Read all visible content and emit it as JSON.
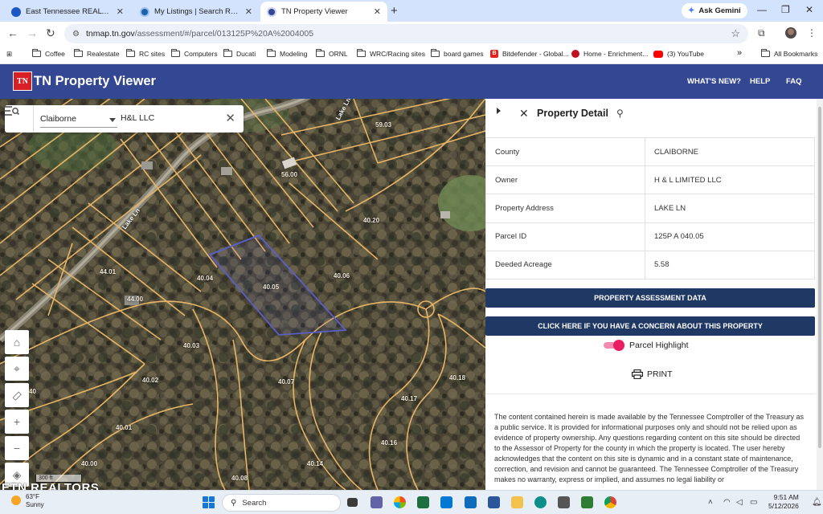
{
  "browser": {
    "tabs": [
      {
        "title": "East Tennessee REALTORS® Da",
        "active": false,
        "favicon_color": "#1a56c4"
      },
      {
        "title": "My Listings | Search Results | fle",
        "active": false,
        "favicon_color": "#1d5fa8"
      },
      {
        "title": "TN Property Viewer",
        "active": true,
        "favicon_color": "#334792"
      }
    ],
    "new_tab_label": "+",
    "ask_gemini_label": "Ask Gemini",
    "url_host": "tnmap.tn.gov",
    "url_path": "/assessment/#/parcel/013125P%20A%2004005",
    "bookmarks": [
      {
        "label": "Coffee",
        "type": "folder"
      },
      {
        "label": "Realestate",
        "type": "folder"
      },
      {
        "label": "RC sites",
        "type": "folder"
      },
      {
        "label": "Computers",
        "type": "folder"
      },
      {
        "label": "Ducati",
        "type": "folder"
      },
      {
        "label": "Modeling",
        "type": "folder"
      },
      {
        "label": "ORNL",
        "type": "folder"
      },
      {
        "label": "WRC/Racing sites",
        "type": "folder"
      },
      {
        "label": "board games",
        "type": "folder"
      },
      {
        "label": "Bitdefender - Global...",
        "type": "link",
        "icon_color": "#e2231a"
      },
      {
        "label": "Home - Enrichment...",
        "type": "link",
        "icon_color": "#c1121f"
      },
      {
        "label": "(3) YouTube",
        "type": "link",
        "icon_color": "#ff0000"
      }
    ],
    "more_bookmarks": "»",
    "all_bookmarks_label": "All Bookmarks"
  },
  "app": {
    "logo_text": "TN",
    "title": "TN Property Viewer",
    "nav": [
      "WHAT'S NEW?",
      "HELP",
      "FAQ"
    ],
    "header_color": "#334792",
    "brand_red": "#d71f26"
  },
  "search": {
    "county": "Claiborne",
    "query": "H&L LLC"
  },
  "map": {
    "road_label": "Lake Ln",
    "scale_label": "300 ft",
    "parcel_labels": [
      "59.03",
      "56.00",
      "40.20",
      "44.01",
      "40.04",
      "40.05",
      "40.06",
      "44.00",
      "40.03",
      "40.02",
      "40.07",
      "40.18",
      "40.17",
      "40.01",
      "40.16",
      "40.00",
      "40.14",
      "40.08",
      "40"
    ],
    "parcel_line_color": "#e6b565",
    "highlight_color": "#5b5fc7",
    "watermark": "ETN REALTORS"
  },
  "property_detail": {
    "title": "Property Detail",
    "fields": [
      {
        "label": "County",
        "value": "CLAIBORNE"
      },
      {
        "label": "Owner",
        "value": "H & L LIMITED LLC"
      },
      {
        "label": "Property Address",
        "value": "LAKE LN"
      },
      {
        "label": "Parcel ID",
        "value": "125P A 040.05"
      },
      {
        "label": "Deeded Acreage",
        "value": "5.58"
      }
    ],
    "assessment_button": "PROPERTY ASSESSMENT DATA",
    "concern_button": "CLICK HERE IF YOU HAVE A CONCERN ABOUT THIS PROPERTY",
    "highlight_toggle_label": "Parcel Highlight",
    "highlight_on": true,
    "print_label": "PRINT",
    "disclaimer": "The content contained herein is made available by the Tennessee Comptroller of the Treasury as a public service. It is provided for informational purposes only and should not be relied upon as evidence of property ownership. Any questions regarding content on this site should be directed to the Assessor of Property for the county in which the property is located. The user hereby acknowledges that the content on this site is dynamic and in a constant state of maintenance, correction, and revision and cannot be guaranteed. The Tennessee Comptroller of the Treasury makes no warranty, express or implied, and assumes no legal liability or",
    "button_color": "#1f3864",
    "toggle_color": "#e91e63"
  },
  "taskbar": {
    "weather_temp": "63°F",
    "weather_desc": "Sunny",
    "search_label": "Search",
    "time": "9:51 AM",
    "date": "5/12/2026"
  }
}
